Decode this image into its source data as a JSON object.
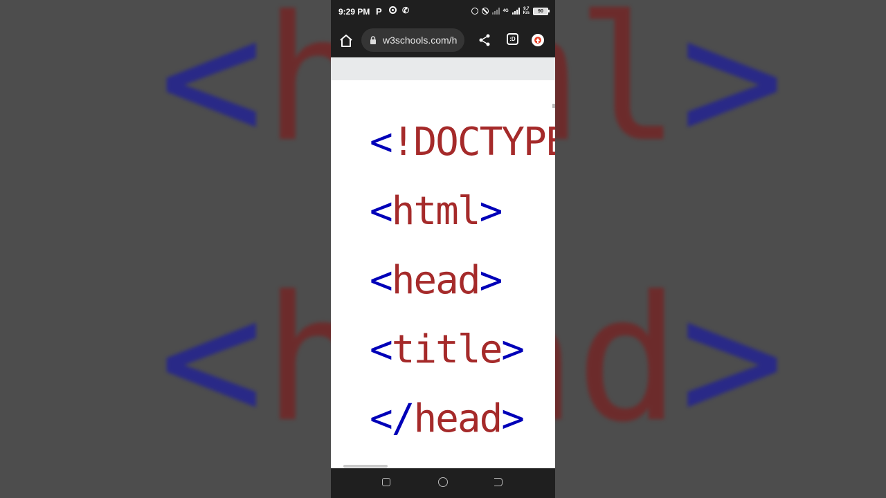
{
  "background": {
    "line1": {
      "open": "<",
      "name": "html",
      "close": ">"
    },
    "line2": {
      "open": "<",
      "name": "head",
      "close": ">"
    }
  },
  "status_bar": {
    "time": "9:29 PM",
    "p_glyph": "P",
    "net_type": "4G",
    "speed_value": "9.7",
    "speed_unit": "K/s",
    "battery": "90"
  },
  "browser": {
    "url": "w3schools.com/h",
    "tabs_label": ":D",
    "icons": [
      "home-icon",
      "lock-icon",
      "share-icon",
      "tab-switcher-icon",
      "update-icon"
    ]
  },
  "code": [
    {
      "open": "<",
      "name": "!DOCTYPE",
      "close": ""
    },
    {
      "open": "<",
      "name": "html",
      "close": ">"
    },
    {
      "open": "<",
      "name": "head",
      "close": ">"
    },
    {
      "open": "<",
      "name": "title",
      "close": ">"
    },
    {
      "open": "</",
      "name": "head",
      "close": ">"
    }
  ],
  "colors": {
    "tag_bracket": "#0000b8",
    "tag_name": "#a52a2a",
    "system_bar": "#1f1f1f"
  }
}
